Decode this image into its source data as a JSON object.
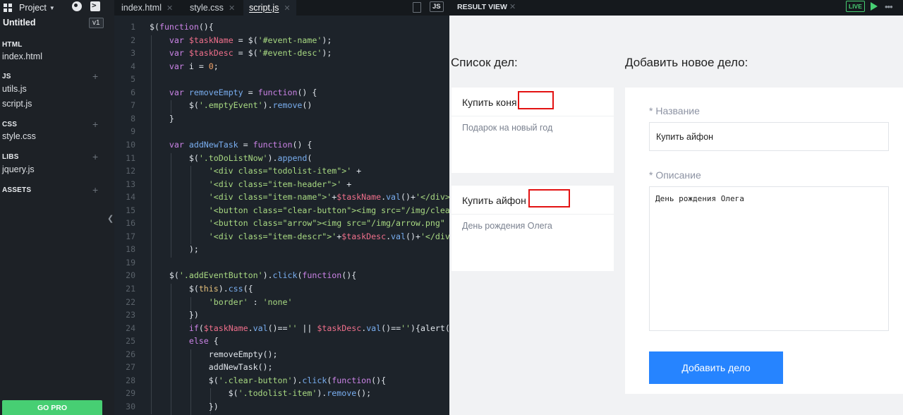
{
  "sidebar": {
    "project_label": "Project",
    "untitled": "Untitled",
    "version": "v1",
    "sections": [
      {
        "title": "HTML",
        "files": [
          "index.html"
        ]
      },
      {
        "title": "JS",
        "files": [
          "utils.js",
          "script.js"
        ]
      },
      {
        "title": "CSS",
        "files": [
          "style.css"
        ]
      },
      {
        "title": "LIBS",
        "files": [
          "jquery.js"
        ]
      },
      {
        "title": "ASSETS",
        "files": []
      }
    ],
    "go_pro": "GO PRO"
  },
  "editor": {
    "tabs": [
      {
        "label": "index.html"
      },
      {
        "label": "style.css"
      },
      {
        "label": "script.js"
      }
    ],
    "active_tab": "script.js",
    "lang_badge": "JS",
    "line_numbers": [
      "1",
      "2",
      "3",
      "4",
      "5",
      "6",
      "7",
      "8",
      "9",
      "10",
      "11",
      "12",
      "13",
      "14",
      "15",
      "16",
      "17",
      "18",
      "19",
      "20",
      "21",
      "22",
      "23",
      "24",
      "25",
      "26",
      "27",
      "28",
      "29",
      "30"
    ],
    "lines": [
      "$(function(){",
      "    var $taskName = $('#event-name');",
      "    var $taskDesc = $('#event-desc');",
      "    var i = 0;",
      "",
      "    var removeEmpty = function() {",
      "        $('.emptyEvent').remove()",
      "    }",
      "",
      "    var addNewTask = function() {",
      "        $('.toDoListNow').append(",
      "            '<div class=\"todolist-item\">' +",
      "            '<div class=\"item-header\">' +",
      "            '<div class=\"item-name\">'+$taskName.val()+'</div>",
      "            '<button class=\"clear-button\"><img src=\"/img/clea",
      "            '<button class=\"arrow\"><img src=\"/img/arrow.png\"",
      "            '<div class=\"item-descr\">'+$taskDesc.val()+'</div",
      "        );",
      "",
      "    $('.addEventButton').click(function(){",
      "        $(this).css({",
      "            'border' : 'none'",
      "        })",
      "        if($taskName.val()=='' || $taskDesc.val()==''){alert(",
      "        else {",
      "            removeEmpty();",
      "            addNewTask();",
      "            $('.clear-button').click(function(){",
      "                $('.todolist-item').remove();",
      "            })"
    ]
  },
  "result": {
    "title": "RESULT VIEW",
    "live": "LIVE",
    "list_heading": "Список дел:",
    "add_heading": "Добавить новое дело:",
    "items": [
      {
        "name": "Купить коня",
        "desc": "Подарок на новый год"
      },
      {
        "name": "Купить айфон",
        "desc": "День рождения Олега"
      }
    ],
    "form": {
      "name_label": "* Название",
      "name_value": "Купить айфон",
      "desc_label": "* Описание",
      "desc_value": "День рождения Олега",
      "button": "Добавить дело"
    }
  },
  "colors": {
    "accent_green": "#47cf73",
    "button_blue": "#2684ff",
    "clear_button_border": "#e31212"
  }
}
